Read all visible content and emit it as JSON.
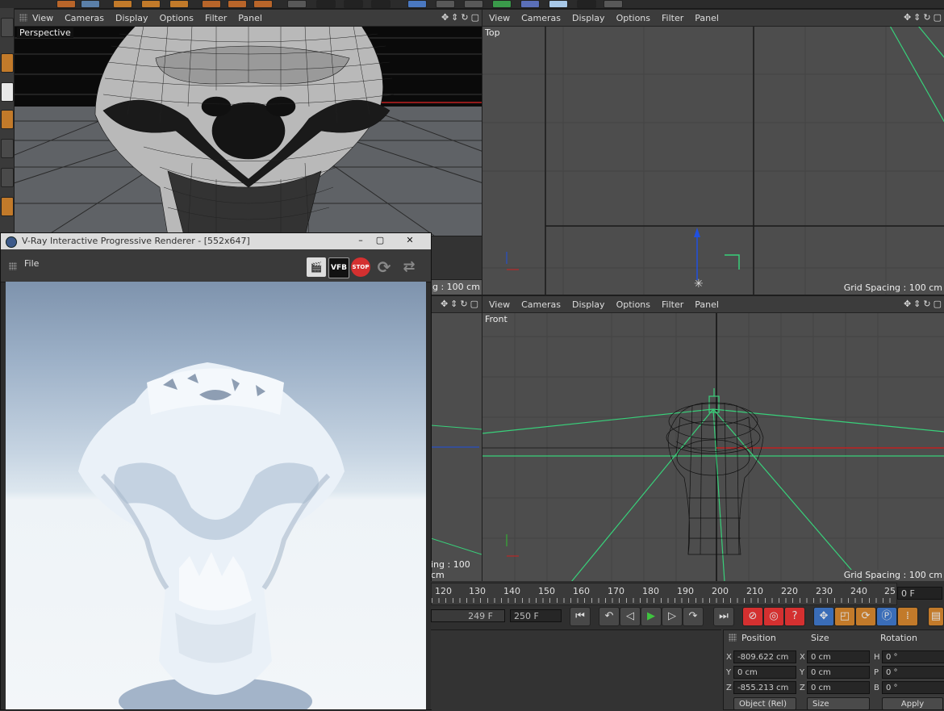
{
  "viewports": {
    "perspective": {
      "name": "Perspective",
      "menu": [
        "View",
        "Cameras",
        "Display",
        "Options",
        "Filter",
        "Panel"
      ],
      "grid_spacing": "g : 100 cm"
    },
    "top": {
      "name": "Top",
      "menu": [
        "View",
        "Cameras",
        "Display",
        "Options",
        "Filter",
        "Panel"
      ],
      "grid_spacing": "Grid Spacing : 100 cm"
    },
    "front": {
      "name": "Front",
      "menu": [
        "View",
        "Cameras",
        "Display",
        "Options",
        "Filter",
        "Panel"
      ],
      "grid_spacing": "Grid Spacing : 100 cm"
    },
    "right_partial": {
      "grid_spacing": "ing : 100 cm"
    }
  },
  "vray": {
    "title": "V-Ray Interactive Progressive Renderer - [552x647]",
    "menu_file": "File",
    "toolbar": {
      "vfb_label": "VFB",
      "stop_label": "STOP"
    }
  },
  "timeline": {
    "ticks": [
      "120",
      "130",
      "140",
      "150",
      "160",
      "170",
      "180",
      "190",
      "200",
      "210",
      "220",
      "230",
      "240",
      "25"
    ],
    "current_frame": "0 F",
    "end_field": "249 F",
    "max_field": "250 F"
  },
  "coords": {
    "headers": {
      "position": "Position",
      "size": "Size",
      "rotation": "Rotation"
    },
    "rows": [
      {
        "axis": "X",
        "pos": "-809.622 cm",
        "saxis": "X",
        "size": "0 cm",
        "raxis": "H",
        "rot": "0 °"
      },
      {
        "axis": "Y",
        "pos": "0 cm",
        "saxis": "Y",
        "size": "0 cm",
        "raxis": "P",
        "rot": "0 °"
      },
      {
        "axis": "Z",
        "pos": "-855.213 cm",
        "saxis": "Z",
        "size": "0 cm",
        "raxis": "B",
        "rot": "0 °"
      }
    ],
    "mode_dropdown": "Object (Rel)",
    "size_dropdown": "Size",
    "apply_label": "Apply"
  },
  "colors": {
    "accent_orange": "#e08a2a",
    "stop_red": "#d43030",
    "play_green": "#3fc43f",
    "axis_red": "#d02020",
    "axis_green": "#2fc02f",
    "axis_blue": "#2050e0",
    "camera_line": "#38d07a"
  }
}
